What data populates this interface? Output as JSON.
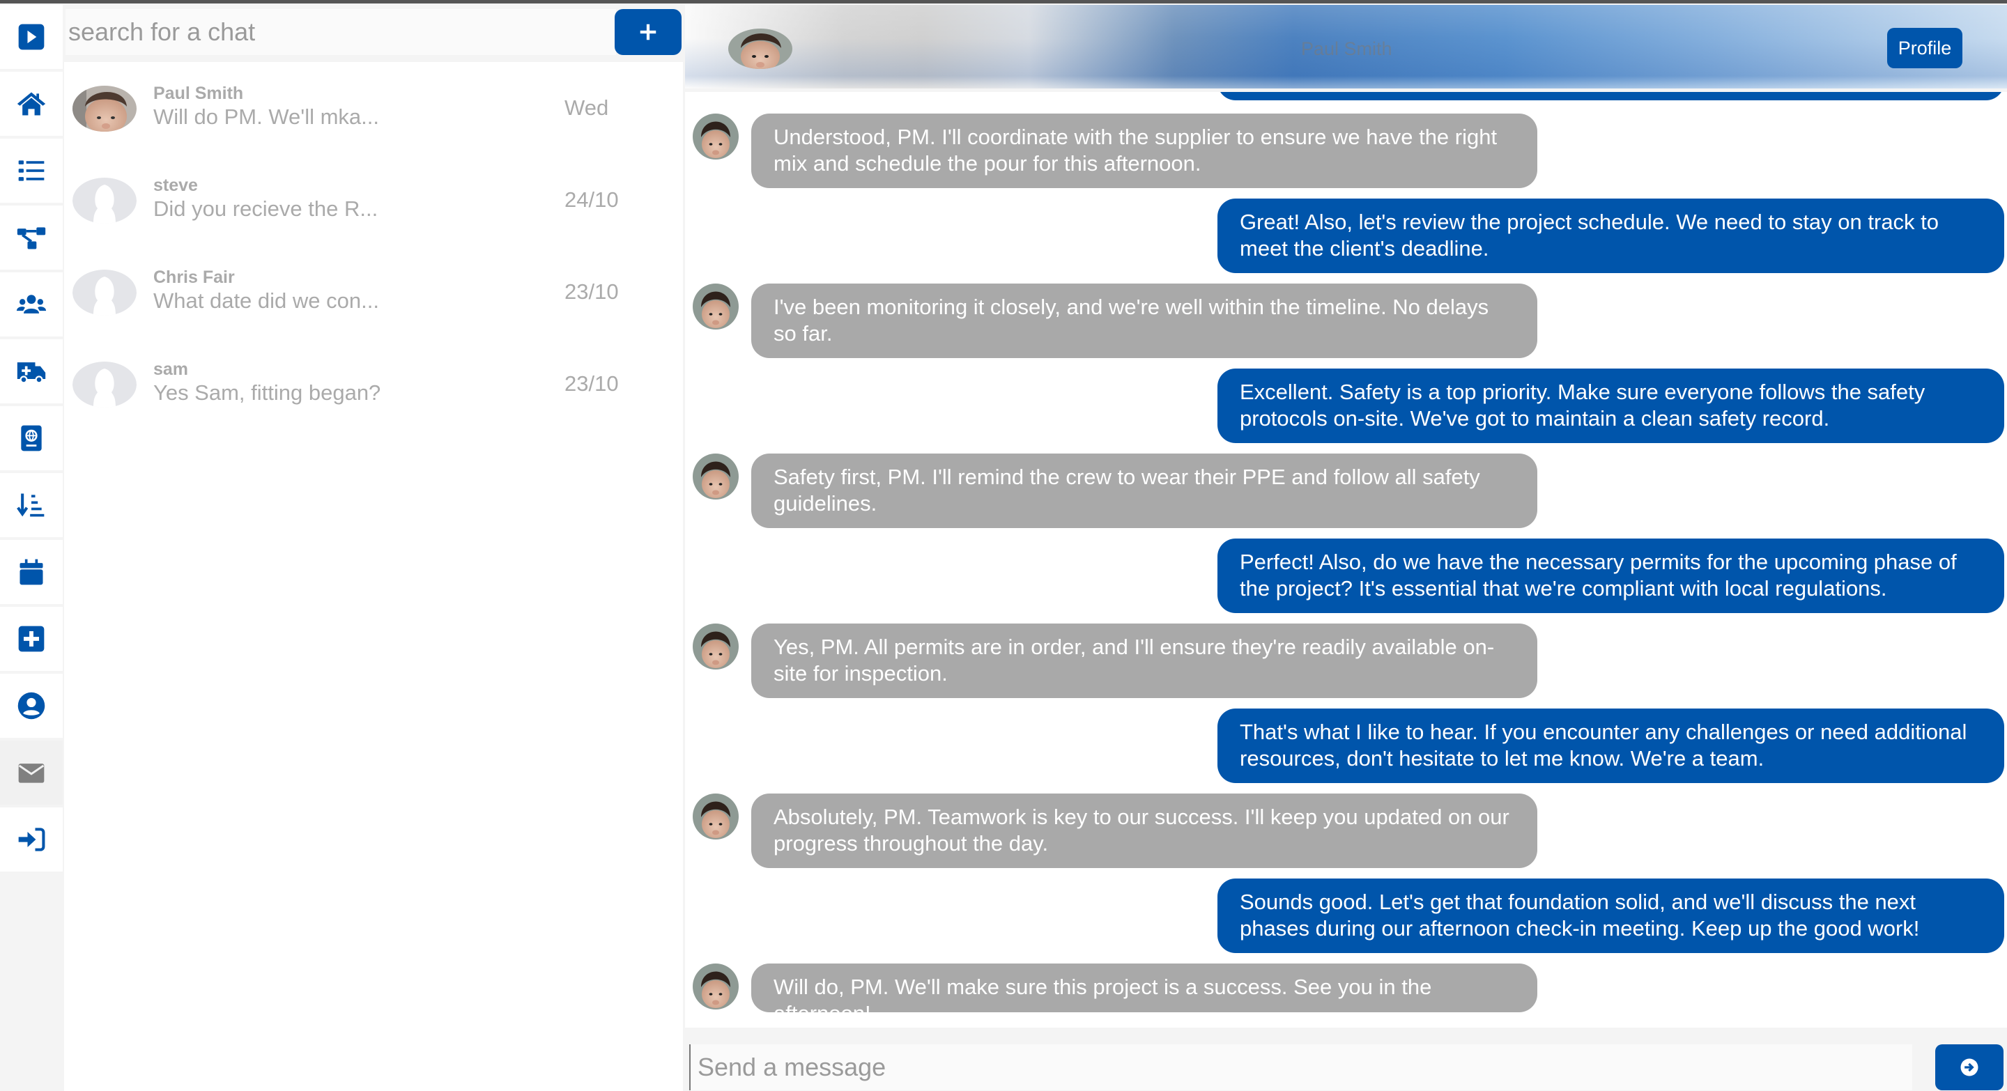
{
  "sidebar": {
    "items": [
      {
        "name": "expand",
        "icon": "play-square-icon"
      },
      {
        "name": "home",
        "icon": "home-icon"
      },
      {
        "name": "list",
        "icon": "list-icon"
      },
      {
        "name": "workflow",
        "icon": "sitemap-icon"
      },
      {
        "name": "team",
        "icon": "users-icon"
      },
      {
        "name": "ambulance",
        "icon": "ambulance-icon"
      },
      {
        "name": "passport",
        "icon": "passport-icon"
      },
      {
        "name": "sort",
        "icon": "sort-amount-down-icon"
      },
      {
        "name": "calendar",
        "icon": "calendar-icon"
      },
      {
        "name": "add",
        "icon": "plus-square-icon"
      },
      {
        "name": "profile",
        "icon": "user-circle-icon"
      },
      {
        "name": "messages",
        "icon": "envelope-icon",
        "active": true
      },
      {
        "name": "sign-in",
        "icon": "sign-in-icon"
      }
    ],
    "accent_color": "#0055ab"
  },
  "chat_list": {
    "search_placeholder": "search for a chat",
    "new_chat_label": "+",
    "items": [
      {
        "name": "Paul Smith",
        "preview": "Will do PM. We'll mka...",
        "date": "Wed",
        "avatar": "photo"
      },
      {
        "name": "steve",
        "preview": "Did you recieve the R...",
        "date": "24/10",
        "avatar": "placeholder"
      },
      {
        "name": "Chris Fair",
        "preview": "What date did we con...",
        "date": "23/10",
        "avatar": "placeholder"
      },
      {
        "name": "sam",
        "preview": "Yes Sam, fitting began?",
        "date": "23/10",
        "avatar": "placeholder"
      }
    ]
  },
  "chat": {
    "header": {
      "name": "Paul Smith",
      "profile_label": "Profile"
    },
    "messages": [
      {
        "from": "them",
        "text": "Understood, PM. I'll coordinate with the supplier to ensure we have the right mix and schedule the pour for this afternoon."
      },
      {
        "from": "me",
        "text": "Great! Also, let's review the project schedule. We need to stay on track to meet the client's deadline."
      },
      {
        "from": "them",
        "text": "I've been monitoring it closely, and we're well within the timeline. No delays so far."
      },
      {
        "from": "me",
        "text": "Excellent. Safety is a top priority. Make sure everyone follows the safety protocols on-site. We've got to maintain a clean safety record."
      },
      {
        "from": "them",
        "text": "Safety first, PM. I'll remind the crew to wear their PPE and follow all safety guidelines."
      },
      {
        "from": "me",
        "text": "Perfect! Also, do we have the necessary permits for the upcoming phase of the project? It's essential that we're compliant with local regulations."
      },
      {
        "from": "them",
        "text": "Yes, PM. All permits are in order, and I'll ensure they're readily available on-site for inspection."
      },
      {
        "from": "me",
        "text": "That's what I like to hear. If you encounter any challenges or need additional resources, don't hesitate to let me know. We're a team."
      },
      {
        "from": "them",
        "text": "Absolutely, PM. Teamwork is key to our success. I'll keep you updated on our progress throughout the day."
      },
      {
        "from": "me",
        "text": "Sounds good. Let's get that foundation solid, and we'll discuss the next phases during our afternoon check-in meeting. Keep up the good work!"
      },
      {
        "from": "them",
        "text": "Will do, PM. We'll make sure this project is a success. See you in the afternoon!"
      }
    ],
    "composer": {
      "placeholder": "Send a message",
      "send_icon": "arrow-circle-right-icon"
    },
    "colors": {
      "outgoing_bubble": "#0055ab",
      "incoming_bubble": "#a9a9a9"
    }
  }
}
